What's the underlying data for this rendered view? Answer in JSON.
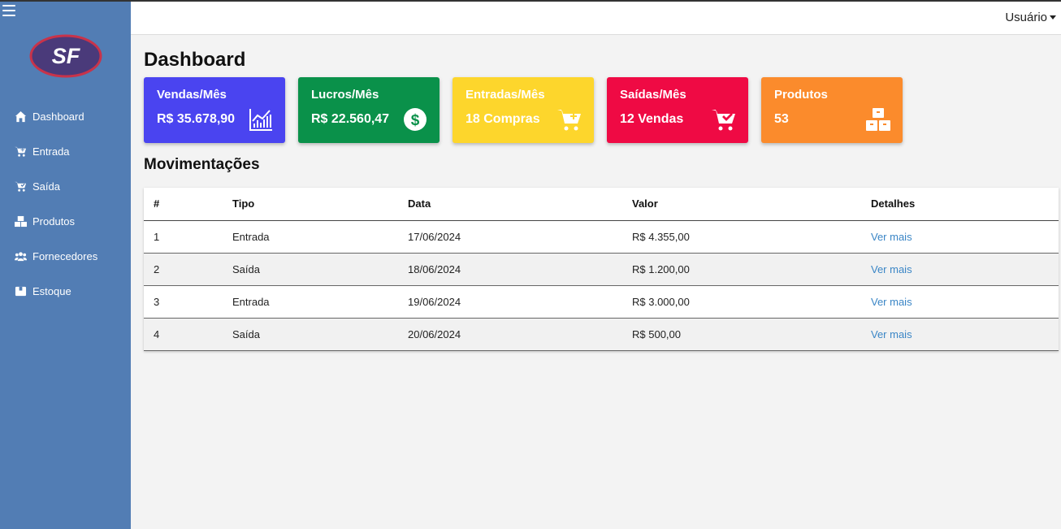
{
  "nav": {
    "logo_text": "SF",
    "items": [
      {
        "label": "Dashboard",
        "icon": "home-icon"
      },
      {
        "label": "Entrada",
        "icon": "cart-in-icon"
      },
      {
        "label": "Saída",
        "icon": "cart-out-icon"
      },
      {
        "label": "Produtos",
        "icon": "boxes-icon"
      },
      {
        "label": "Fornecedores",
        "icon": "users-icon"
      },
      {
        "label": "Estoque",
        "icon": "warehouse-icon"
      }
    ]
  },
  "topbar": {
    "user_label": "Usuário"
  },
  "page": {
    "title": "Dashboard",
    "section_title": "Movimentações"
  },
  "cards": [
    {
      "title": "Vendas/Mês",
      "value": "R$ 35.678,90",
      "color": "#4a44f0",
      "icon": "chart-icon"
    },
    {
      "title": "Lucros/Mês",
      "value": "R$ 22.560,47",
      "color": "#0a914a",
      "icon": "dollar-icon"
    },
    {
      "title": "Entradas/Mês",
      "value": "18 Compras",
      "color": "#fdd62c",
      "icon": "cart-plus-icon"
    },
    {
      "title": "Saídas/Mês",
      "value": "12 Vendas",
      "color": "#ef0a44",
      "icon": "cart-check-icon"
    },
    {
      "title": "Produtos",
      "value": "53",
      "color": "#fb8b2c",
      "icon": "boxes-icon"
    }
  ],
  "table": {
    "headers": [
      "#",
      "Tipo",
      "Data",
      "Valor",
      "Detalhes"
    ],
    "rows": [
      {
        "id": "1",
        "tipo": "Entrada",
        "data": "17/06/2024",
        "valor": "R$ 4.355,00",
        "link": "Ver mais"
      },
      {
        "id": "2",
        "tipo": "Saída",
        "data": "18/06/2024",
        "valor": "R$ 1.200,00",
        "link": "Ver mais"
      },
      {
        "id": "3",
        "tipo": "Entrada",
        "data": "19/06/2024",
        "valor": "R$ 3.000,00",
        "link": "Ver mais"
      },
      {
        "id": "4",
        "tipo": "Saída",
        "data": "20/06/2024",
        "valor": "R$ 500,00",
        "link": "Ver mais"
      }
    ]
  }
}
